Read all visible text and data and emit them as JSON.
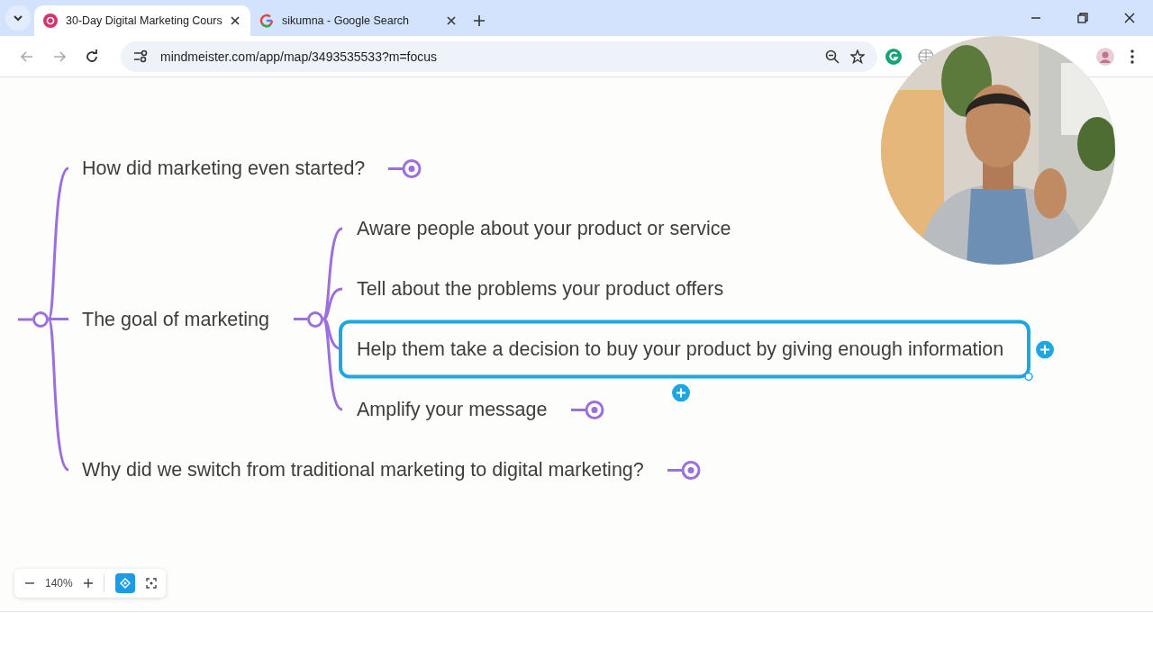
{
  "browser": {
    "tabs": [
      {
        "title": "30-Day Digital Marketing Cours",
        "selected": true,
        "kind": "app"
      },
      {
        "title": "sikumna - Google Search",
        "selected": false,
        "kind": "search"
      }
    ],
    "url": "mindmeister.com/app/map/3493535533?m=focus"
  },
  "mind_map": {
    "topics": [
      {
        "text": "How did marketing even started?",
        "expanded": false,
        "selected": false
      },
      {
        "text": "The goal of marketing",
        "expanded": true,
        "selected": false,
        "children": [
          {
            "text": "Aware people about your product or service",
            "selected": false
          },
          {
            "text": "Tell about the problems your product offers",
            "selected": false
          },
          {
            "text": "Help them take a decision to buy your product by giving enough information",
            "selected": true
          },
          {
            "text": "Amplify your message",
            "expanded": false,
            "selected": false
          }
        ]
      },
      {
        "text": "Why did we switch from traditional marketing to digital marketing?",
        "expanded": false,
        "selected": false
      }
    ]
  },
  "zoom_controls": {
    "zoom_level": "140%",
    "focus_mode": true
  }
}
